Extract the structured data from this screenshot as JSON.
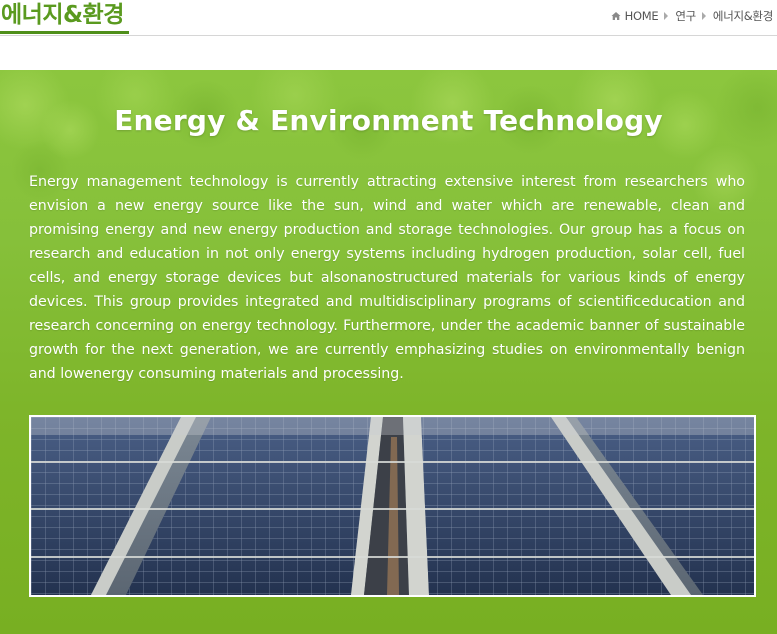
{
  "header": {
    "page_title": "에너지&환경",
    "breadcrumb": {
      "home_label": "HOME",
      "items": [
        "연구",
        "에너지&환경"
      ]
    }
  },
  "panel": {
    "heading": "Energy & Environment Technology",
    "body": "Energy management technology is currently attracting extensive interest from researchers who envision a new energy source like the sun, wind and water which are renewable, clean and promising energy and new energy production and storage technologies. Our group has a focus on research and education in not only energy systems including hydrogen production, solar cell, fuel cells, and energy storage devices but alsonanostructured materials for various kinds of energy devices. This group provides integrated and multidisciplinary programs of scientificeducation and research concerning on energy technology. Furthermore, under the academic banner of sustainable growth for the next generation, we are currently emphasizing studies on environmentally benign and lowenergy consuming materials and processing.",
    "image_subject": "solar panels array"
  },
  "colors": {
    "title_green": "#5a9a1f",
    "panel_green": "#82bb32",
    "text_white": "#ffffff"
  },
  "icons": [
    "home-icon",
    "breadcrumb-arrow-icon"
  ]
}
